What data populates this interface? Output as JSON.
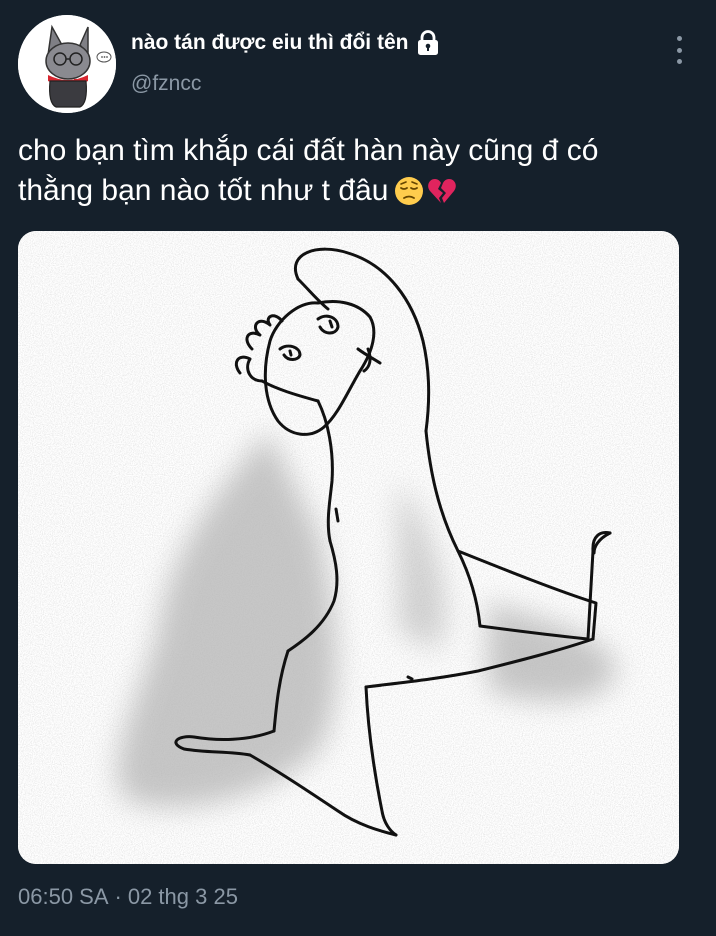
{
  "author": {
    "display_name": "nào tán được eiu thì đổi tên",
    "handle": "@fzncc",
    "protected": true,
    "avatar_icon": "cat-avatar-icon",
    "lock_icon": "lock-icon"
  },
  "menu": {
    "more_icon": "more-vertical-icon"
  },
  "tweet": {
    "line1": "cho bạn tìm khắp cái đất hàn này cũng đ có",
    "line2": "thằng bạn nào tốt như t đâu",
    "emojis": [
      "pensive-face-icon",
      "broken-heart-icon"
    ]
  },
  "media": {
    "kind": "drawing"
  },
  "meta": {
    "time": "06:50 SA",
    "separator": "·",
    "date": "02 thg 3 25"
  },
  "colors": {
    "background": "#15202b",
    "primary_text": "#ffffff",
    "secondary_text": "#8b98a5",
    "broken_heart": "#e0245e",
    "pensive_face": "#ffcc4d"
  }
}
